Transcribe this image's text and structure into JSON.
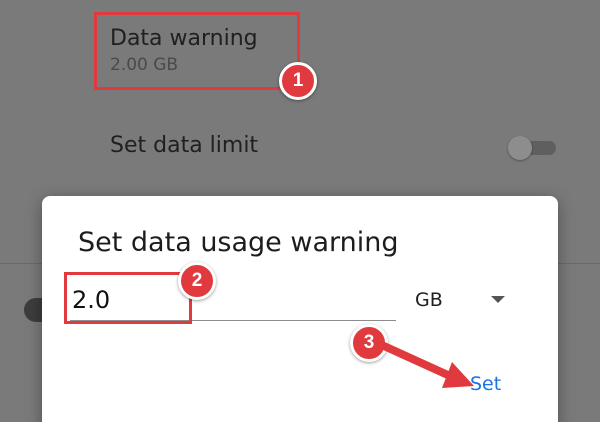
{
  "settings": {
    "data_warning": {
      "title": "Data warning",
      "value": "2.00 GB"
    },
    "data_limit": {
      "title": "Set data limit",
      "toggle_on": false
    }
  },
  "dialog": {
    "title": "Set data usage warning",
    "input_value": "2.0",
    "unit": "GB",
    "set_label": "Set"
  },
  "annotations": {
    "step1": "1",
    "step2": "2",
    "step3": "3",
    "accent_color": "#e0393e",
    "button_color": "#1a73e8"
  },
  "icons": {
    "unit_dropdown": "chevron-down-icon",
    "arrow": "arrow-right-icon"
  }
}
